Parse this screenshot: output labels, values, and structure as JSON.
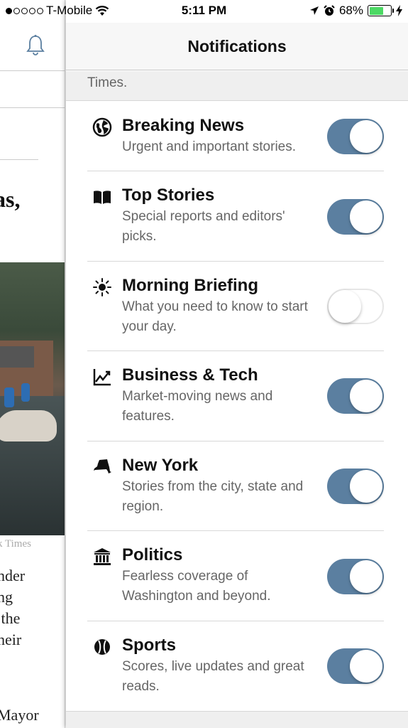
{
  "status_bar": {
    "carrier": "T-Mobile",
    "time": "5:11 PM",
    "battery": "68%",
    "battery_level": 0.68,
    "signal_bars_filled": 1,
    "signal_bars_total": 5
  },
  "background_article": {
    "headline_fragment": "as,",
    "photo_credit_fragment": "k Times",
    "body_lines": [
      "nder",
      "ng",
      " the",
      "heir"
    ],
    "bottom_fragment": "Mayor"
  },
  "panel": {
    "title": "Notifications",
    "intro_fragment": "Times.",
    "accent_color": "#5b7fa0",
    "items": [
      {
        "icon": "globe-icon",
        "name": "Breaking News",
        "description": "Urgent and important stories.",
        "enabled": true
      },
      {
        "icon": "book-icon",
        "name": "Top Stories",
        "description": "Special reports and editors' picks.",
        "enabled": true
      },
      {
        "icon": "sun-icon",
        "name": "Morning Briefing",
        "description": "What you need to know to start your day.",
        "enabled": false
      },
      {
        "icon": "chart-icon",
        "name": "Business & Tech",
        "description": "Market-moving news and features.",
        "enabled": true
      },
      {
        "icon": "new-york-state-icon",
        "name": "New York",
        "description": "Stories from the city, state and region.",
        "enabled": true
      },
      {
        "icon": "capitol-icon",
        "name": "Politics",
        "description": "Fearless coverage of Washington and beyond.",
        "enabled": true
      },
      {
        "icon": "baseball-icon",
        "name": "Sports",
        "description": "Scores, live updates and great reads.",
        "enabled": true
      }
    ]
  }
}
